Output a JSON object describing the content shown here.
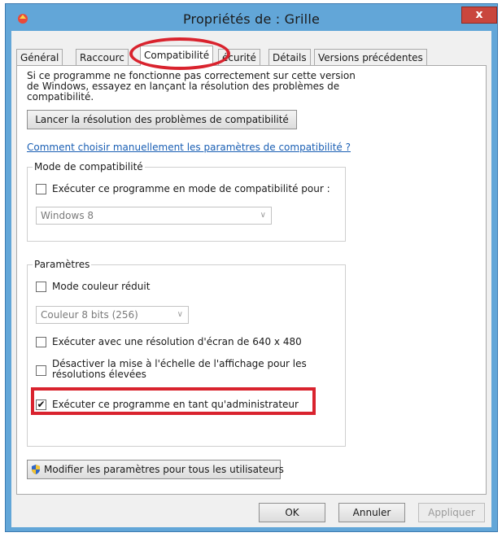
{
  "window": {
    "title": "Propriétés de : Grille",
    "close_label": "x"
  },
  "tabs": [
    {
      "label": "Général"
    },
    {
      "label": "Raccourc"
    },
    {
      "label": "Compatibilité"
    },
    {
      "label": "écurité"
    },
    {
      "label": "Détails"
    },
    {
      "label": "Versions précédentes"
    }
  ],
  "panel": {
    "intro_line1": "Si ce programme ne fonctionne pas correctement sur cette version",
    "intro_line2": "de Windows, essayez en lançant la résolution des problèmes de",
    "intro_line3": "compatibilité.",
    "troubleshoot_label": "Lancer la résolution des problèmes de compatibilité",
    "manual_link": "Comment choisir manuellement les paramètres de compatibilité ?",
    "compat_mode": {
      "group_label": "Mode de compatibilité",
      "checkbox_label": "Exécuter ce programme en mode de compatibilité pour :",
      "select_value": "Windows 8"
    },
    "settings": {
      "group_label": "Paramètres",
      "reduced_color_label": "Mode couleur réduit",
      "color_select_value": "Couleur 8 bits (256)",
      "resolution_label": "Exécuter avec une résolution d'écran de 640 x 480",
      "dpi_label_line1": "Désactiver la mise à l'échelle de l'affichage pour les",
      "dpi_label_line2": "résolutions élevées",
      "admin_label": "Exécuter ce programme en tant qu'administrateur",
      "admin_checked": "✔"
    },
    "all_users_label": "Modifier les paramètres pour tous les utilisateurs"
  },
  "footer": {
    "ok_label": "OK",
    "cancel_label": "Annuler",
    "apply_label": "Appliquer"
  },
  "colors": {
    "accent_red": "#d9232e",
    "title_bar": "#62a6d8",
    "link": "#1a5fb4"
  }
}
